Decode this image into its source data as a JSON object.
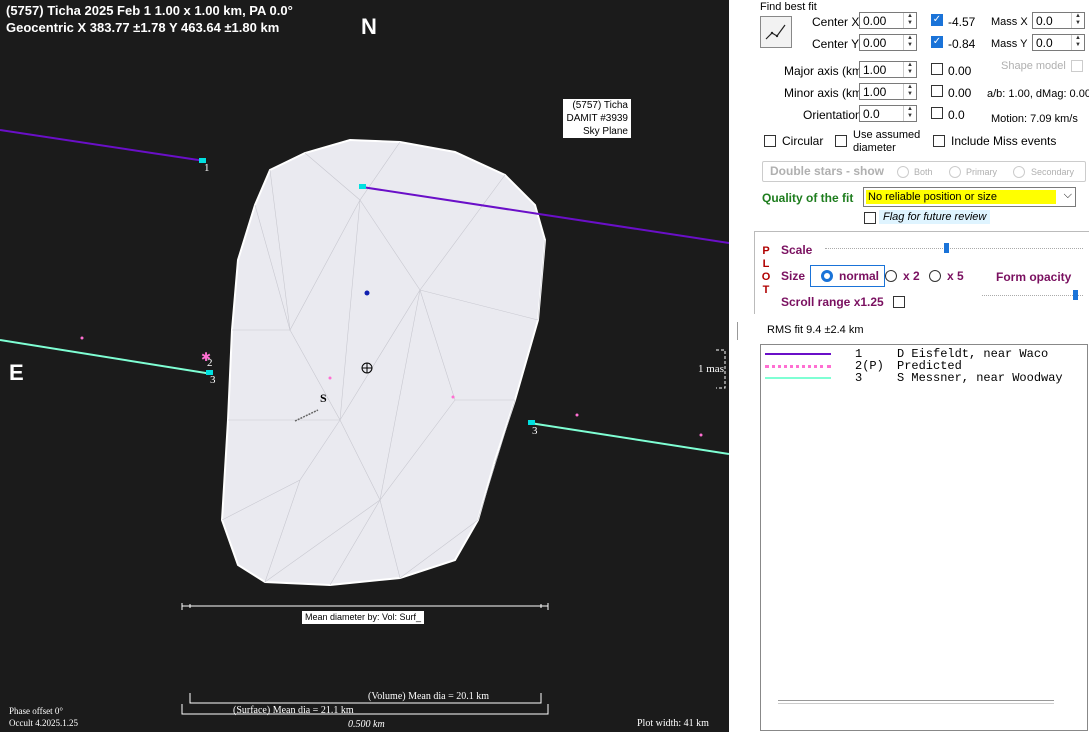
{
  "plot": {
    "title_line1": "(5757) Ticha  2025 Feb 1   1.00 x 1.00 km, PA 0.0°",
    "title_line2": "Geocentric  X  383.77 ±1.78  Y 463.64 ±1.80 km",
    "north_label": "N",
    "east_label": "E",
    "model_label_line1": "(5757) Ticha",
    "model_label_line2": "DAMIT #3939",
    "model_label_line3": "Sky Plane",
    "chord_label_1": "1",
    "chord_label_2": "2",
    "chord_label_3a": "3",
    "chord_label_3b": "3",
    "limb_s_label": "S",
    "one_mas_label": "1 mas",
    "mean_dia_box": "Mean diameter by: Vol: Surf_",
    "volume_mean_dia": "(Volume) Mean dia = 20.1 km",
    "surface_mean_dia": "(Surface) Mean dia = 21.1 km",
    "scale_bar": "0.500 km",
    "phase_offset": "Phase offset 0°",
    "version": "Occult 4.2025.1.25",
    "plot_width": "Plot width: 41 km",
    "colors": {
      "background": "#1b1b1b",
      "chord1": "#6a0fc8",
      "chord3": "#7fffd4",
      "predicted": "#ff6fd2",
      "shape": "#e8e8ee"
    }
  },
  "panel": {
    "find_best_fit": "Find best fit",
    "center_x_label": "Center X",
    "center_x_value": "0.00",
    "center_x_fit": "-4.57",
    "center_y_label": "Center Y",
    "center_y_value": "0.00",
    "center_y_fit": "-0.84",
    "mass_x_label": "Mass X",
    "mass_x_value": "0.0",
    "mass_y_label": "Mass Y",
    "mass_y_value": "0.0",
    "major_label": "Major axis (km)",
    "major_value": "1.00",
    "major_fit": "0.00",
    "minor_label": "Minor axis (km)",
    "minor_value": "1.00",
    "minor_fit": "0.00",
    "orient_label": "Orientation",
    "orient_value": "0.0",
    "orient_fit": "0.0",
    "shape_model": "Shape model",
    "ab_text": "a/b: 1.00, dMag: 0.00",
    "motion_text": "Motion: 7.09 km/s",
    "circular": "Circular",
    "use_assumed_1": "Use assumed",
    "use_assumed_2": "diameter",
    "include_miss": "Include Miss events",
    "double_stars": "Double stars - show",
    "both": "Both",
    "primary": "Primary",
    "secondary": "Secondary",
    "quality_label": "Quality of the fit",
    "quality_value": "No reliable position or size",
    "flag_review": "Flag for future review",
    "plot_letters": [
      "P",
      "L",
      "O",
      "T"
    ],
    "scale_label": "Scale",
    "size_label": "Size",
    "size_normal": "normal",
    "size_x2": "x 2",
    "size_x5": "x 5",
    "form_opacity": "Form opacity",
    "scroll_range": "Scroll range x1.25",
    "rms_fit": "RMS fit 9.4 ±2.4 km",
    "scale_slider_level": 0.47,
    "opacity_slider_level": 0.95,
    "legend": [
      {
        "num": "1",
        "text": "D Eisfeldt, near Waco",
        "color": "#6a0fc8",
        "style": "solid"
      },
      {
        "num": "2(P)",
        "text": "Predicted",
        "color": "#ff6fd2",
        "style": "dotted"
      },
      {
        "num": "3",
        "text": "S Messner, near Woodway",
        "color": "#7fffd4",
        "style": "solid"
      }
    ]
  }
}
